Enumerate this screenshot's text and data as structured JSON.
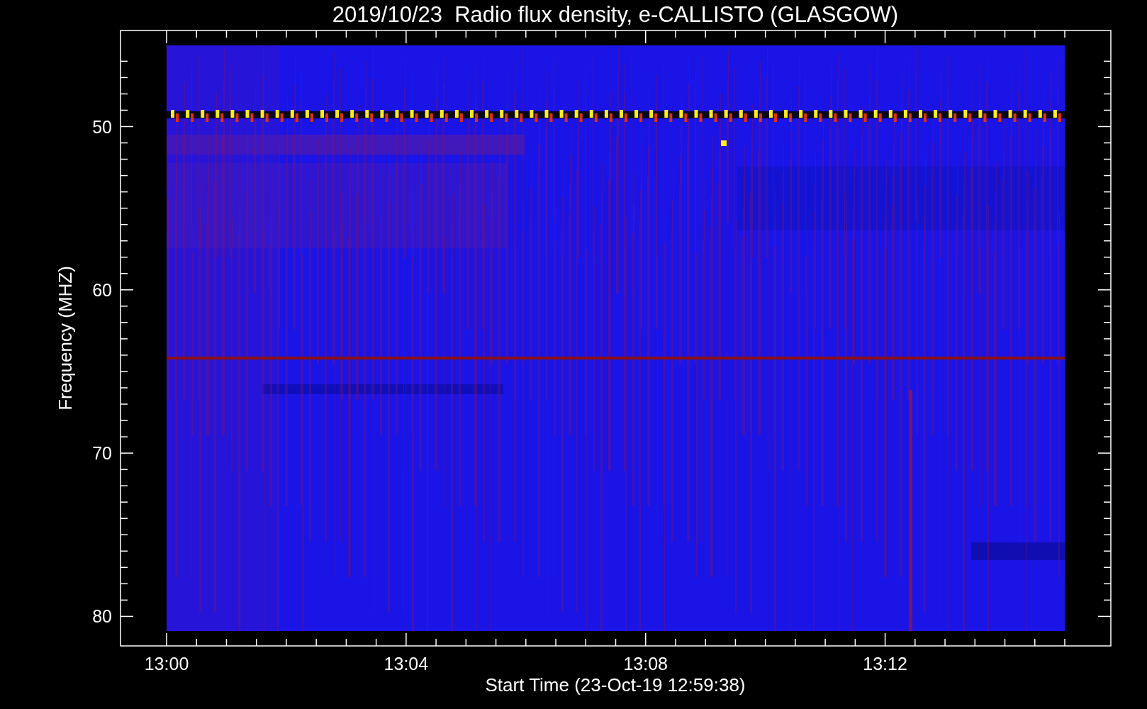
{
  "plot": {
    "title": "2019/10/23  Radio flux density, e-CALLISTO (GLASGOW)",
    "ylabel": "Frequency (MHZ)",
    "xlabel": "Start Time (23-Oct-19 12:59:38)",
    "yticks": [
      "50",
      "60",
      "70",
      "80"
    ],
    "xticks": [
      "13:00",
      "13:04",
      "13:08",
      "13:12"
    ]
  }
}
